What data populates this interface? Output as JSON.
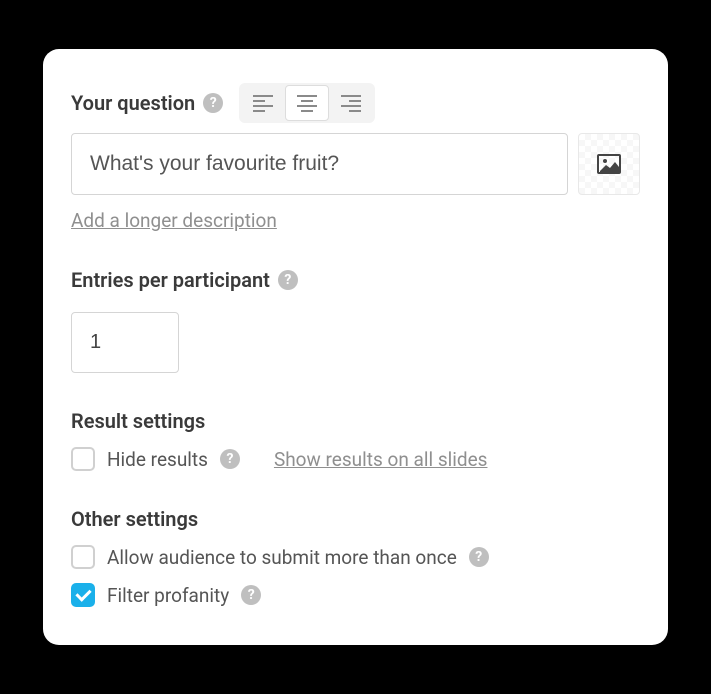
{
  "question": {
    "label": "Your question",
    "value": "What's your favourite fruit?",
    "add_description": "Add a longer description"
  },
  "entries": {
    "label": "Entries per participant",
    "value": "1"
  },
  "result_settings": {
    "label": "Result settings",
    "hide_results": "Hide results",
    "show_all": "Show results on all slides"
  },
  "other_settings": {
    "label": "Other settings",
    "allow_multiple": "Allow audience to submit more than once",
    "filter_profanity": "Filter profanity"
  }
}
